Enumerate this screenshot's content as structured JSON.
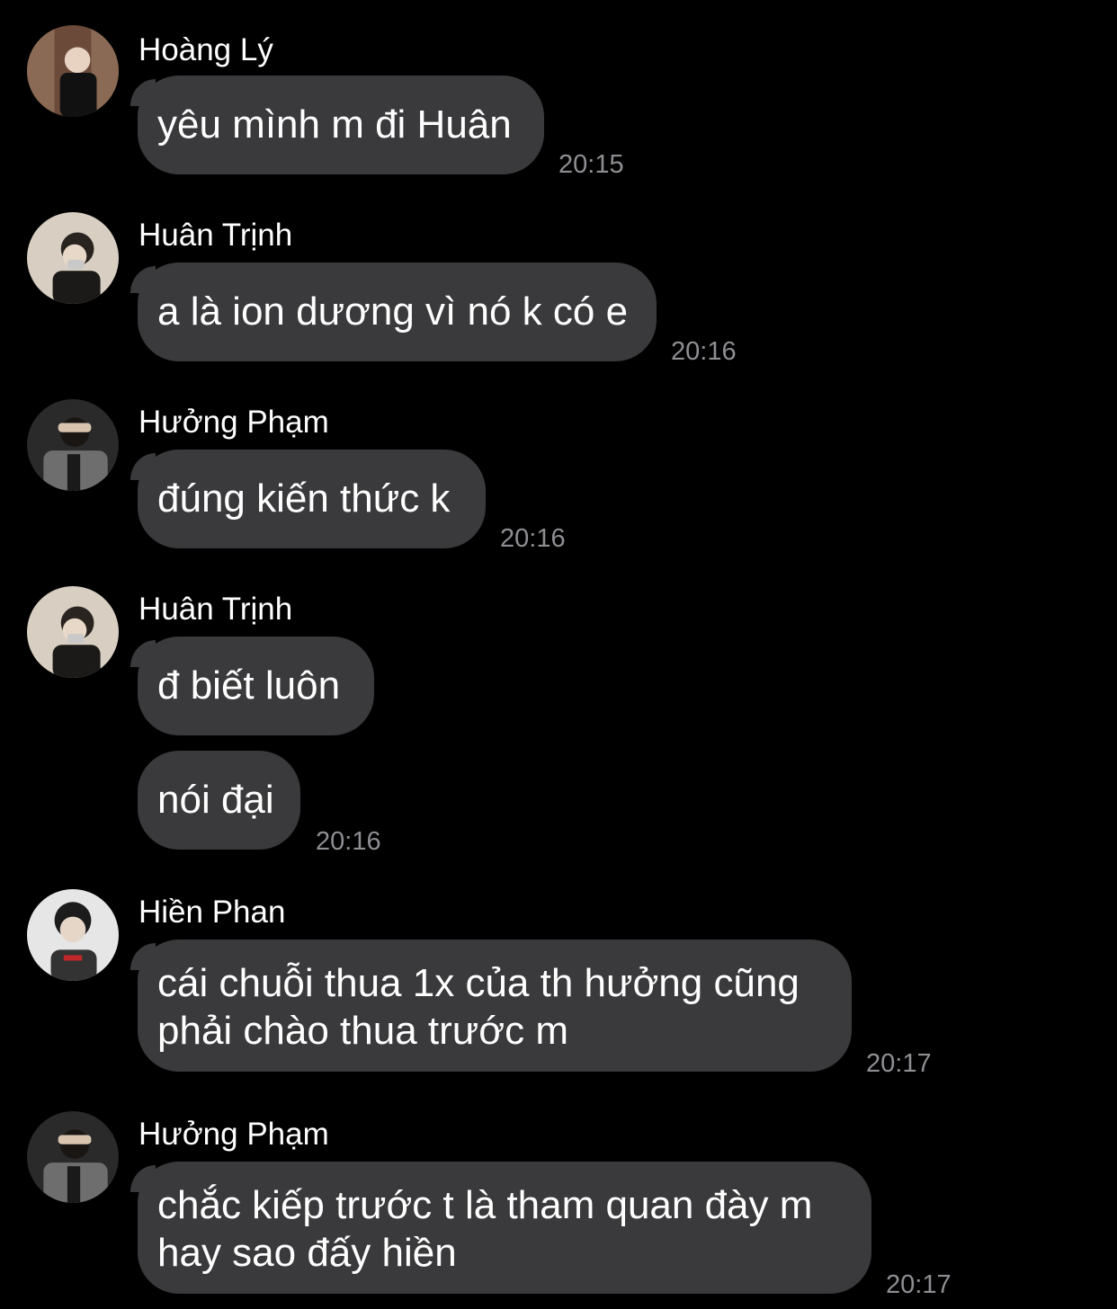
{
  "messages": [
    {
      "sender": "Hoàng Lý",
      "lines": [
        "yêu mình m đi Huân"
      ],
      "time": "20:15"
    },
    {
      "sender": "Huân Trịnh",
      "lines": [
        "a là ion dương vì nó k có e"
      ],
      "time": "20:16"
    },
    {
      "sender": "Hưởng Phạm",
      "lines": [
        "đúng kiến thức k"
      ],
      "time": "20:16"
    },
    {
      "sender": "Huân Trịnh",
      "lines": [
        "đ biết luôn"
      ],
      "time": ""
    },
    {
      "sender": "",
      "lines": [
        "nói đại"
      ],
      "time": "20:16"
    },
    {
      "sender": "Hiền Phan",
      "lines": [
        "cái chuỗi thua 1x của th hưởng cũng",
        "phải chào thua trước m"
      ],
      "time": "20:17"
    },
    {
      "sender": "Hưởng Phạm",
      "lines": [
        "chắc kiếp trước t là tham quan đày m",
        "hay sao đấy hiền"
      ],
      "time": "20:17"
    }
  ],
  "colors": {
    "background": "#000000",
    "bubble": "#3a3a3c",
    "timestamp": "#8e8e93",
    "text": "#ffffff"
  },
  "icons": {
    "avatar": "user-avatar-icon"
  }
}
